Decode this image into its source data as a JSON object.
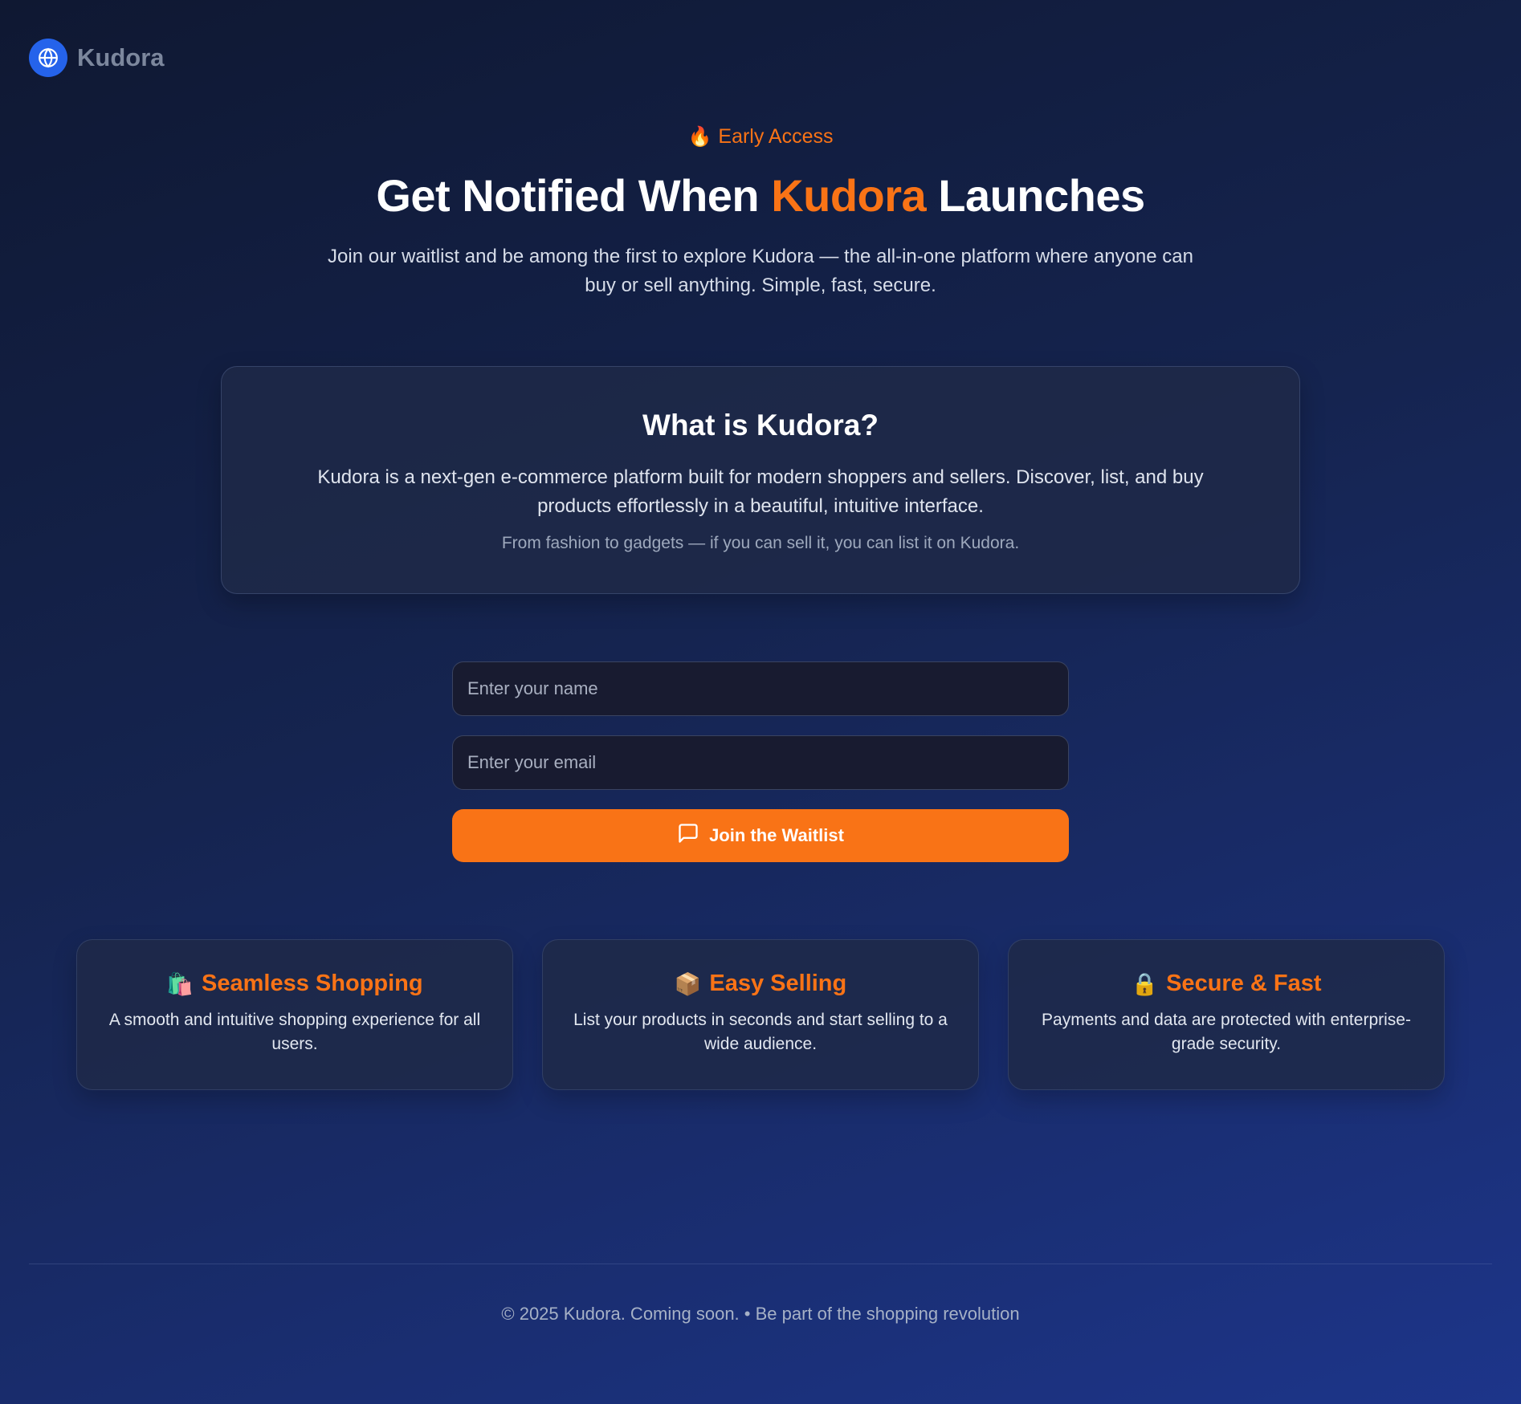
{
  "brand": {
    "name": "Kudora",
    "icon": "globe-icon",
    "logo_color": "#2563eb"
  },
  "hero": {
    "badge_icon": "🔥",
    "badge": "Early Access",
    "title_before": "Get Notified When",
    "title_accent": "Kudora",
    "title_after": "Launches",
    "subtitle": "Join our waitlist and be among the first to explore Kudora — the all-in-one platform where anyone can buy or sell anything. Simple, fast, secure."
  },
  "about": {
    "title": "What is Kudora?",
    "text": "Kudora is a next-gen e-commerce platform built for modern shoppers and sellers. Discover, list, and buy products effortlessly in a beautiful, intuitive interface.",
    "note": "From fashion to gadgets — if you can sell it, you can list it on Kudora."
  },
  "form": {
    "name_placeholder": "Enter your name",
    "name_value": "",
    "email_placeholder": "Enter your email",
    "email_value": "",
    "button_label": "Join the Waitlist",
    "button_icon": "message-icon"
  },
  "features": [
    {
      "emoji": "🛍️",
      "title": "Seamless Shopping",
      "text": "A smooth and intuitive shopping experience for all users."
    },
    {
      "emoji": "📦",
      "title": "Easy Selling",
      "text": "List your products in seconds and start selling to a wide audience."
    },
    {
      "emoji": "🔒",
      "title": "Secure & Fast",
      "text": "Payments and data are protected with enterprise-grade security."
    }
  ],
  "footer": {
    "text": "© 2025 Kudora. Coming soon. • Be part of the shopping revolution"
  },
  "colors": {
    "accent": "#f97316",
    "background_start": "#0f1832",
    "background_end": "#1d358a"
  }
}
